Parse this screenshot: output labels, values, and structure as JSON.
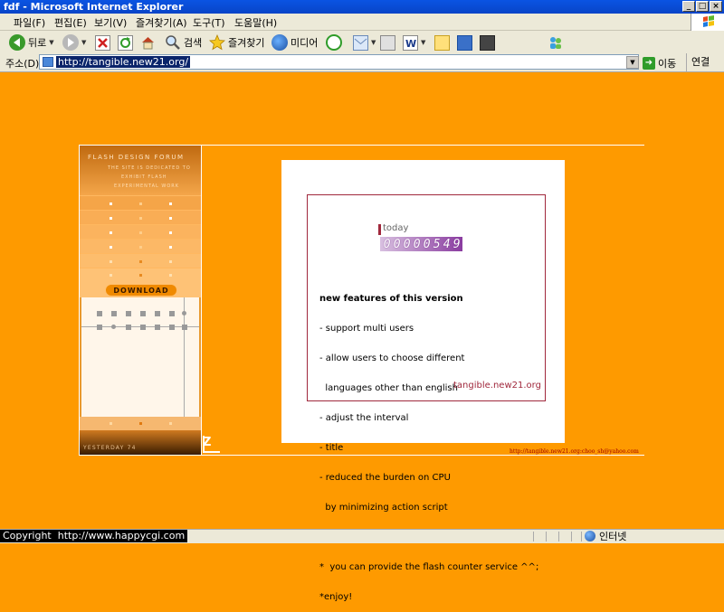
{
  "window": {
    "title": "fdf - Microsoft Internet Explorer",
    "min": "_",
    "max": "□",
    "close": "×"
  },
  "menu": [
    "파일(F)",
    "편집(E)",
    "보기(V)",
    "즐겨찾기(A)",
    "도구(T)",
    "도움말(H)"
  ],
  "toolbar": {
    "back": "뒤로",
    "search": "검색",
    "favorites": "즐겨찾기",
    "media": "미디어"
  },
  "address": {
    "label": "주소(D)",
    "url": "http://tangible.new21.org/",
    "go": "이동",
    "links": "연결"
  },
  "flash": {
    "forum_title": "FLASH DESIGN FORUM",
    "tagline": [
      "THE SITE IS DEDICATED TO",
      "EXHIBIT FLASH",
      "EXPERIMENTAL WORK"
    ],
    "download": "DOWNLOAD",
    "yesterday": "YESTERDAY 74",
    "counter_label": "today",
    "counter_digits": [
      "0",
      "0",
      "0",
      "0",
      "0",
      "5",
      "4",
      "9"
    ],
    "features": [
      "new features of this version",
      "- support multi users",
      "- allow users to choose different",
      "  languages other than english",
      "- adjust the interval",
      "- title",
      "- reduced the burden on CPU",
      "  by minimizing action script",
      "",
      "*  you can provide the flash counter service ^^;",
      "*enjoy!"
    ],
    "site": "tangible.new21.org",
    "email": "http://tangible.new21.org:choo_sh@yahoo.com"
  },
  "status": {
    "zone": "인터넷",
    "copyright": "Copyright  http://www.happycgi.com"
  },
  "colors": {
    "page_bg": "#fe9a00",
    "accent": "#a0283c"
  }
}
